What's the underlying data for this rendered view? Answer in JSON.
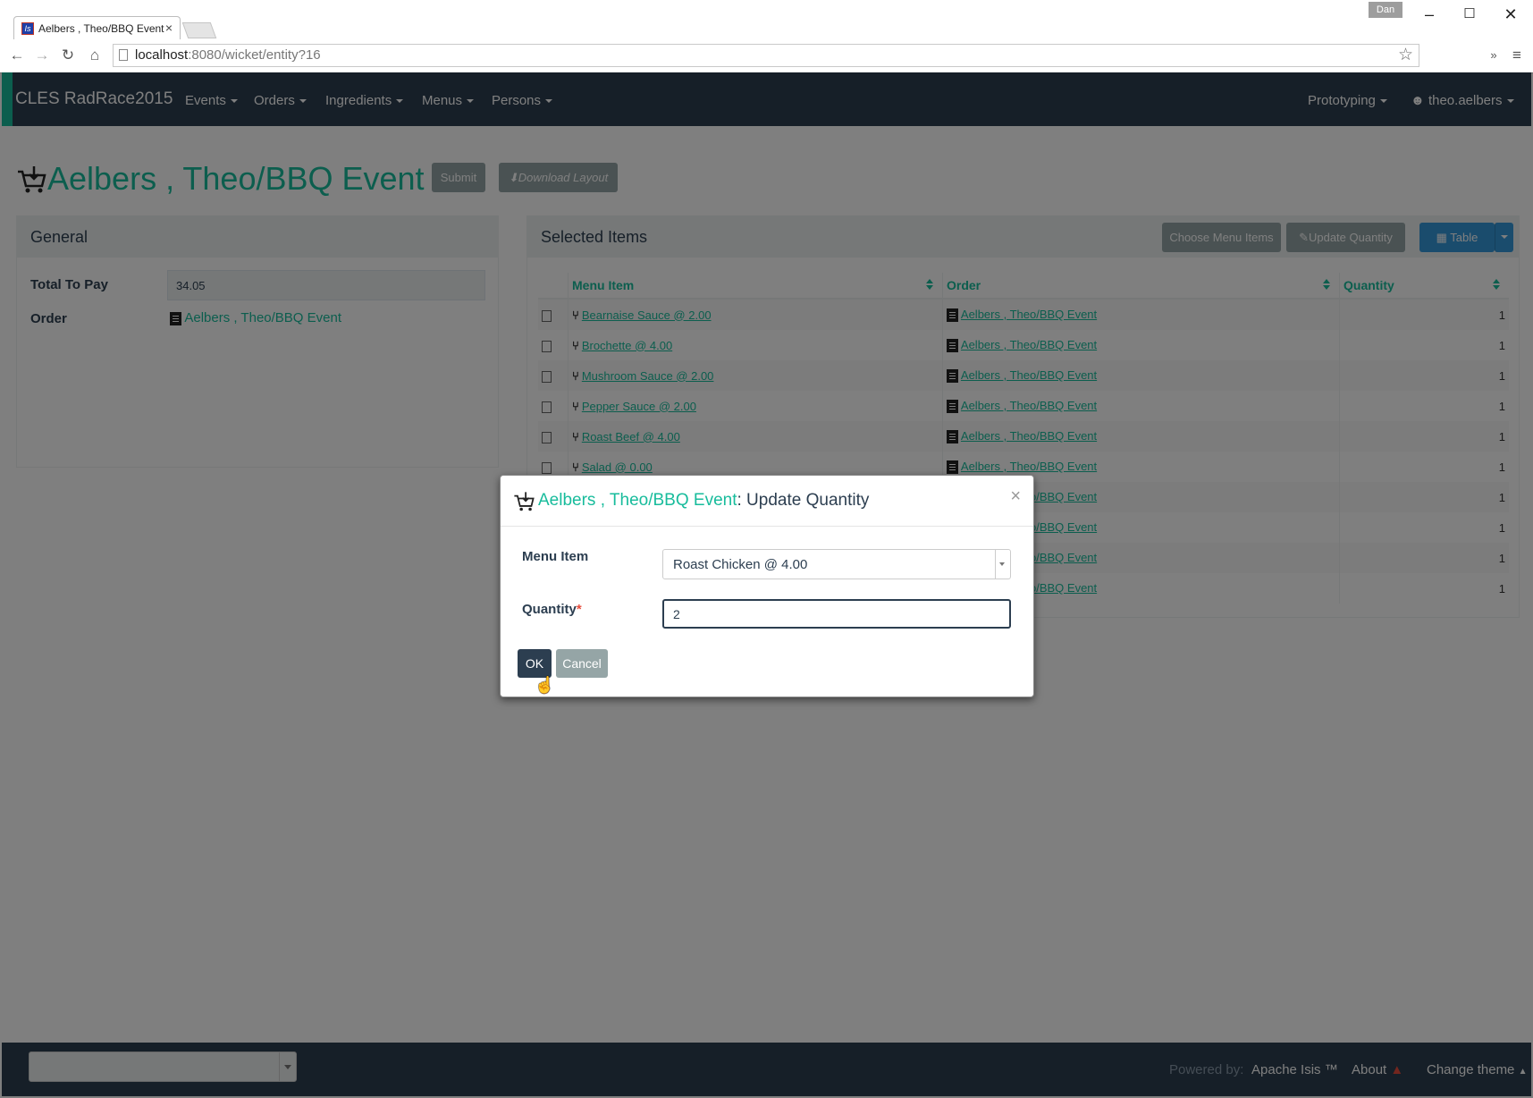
{
  "browser": {
    "tab_title": "Aelbers , Theo/BBQ Event",
    "tab_favicon": "Is",
    "user_badge": "Dan",
    "url_host": "localhost",
    "url_rest": ":8080/wicket/entity?16"
  },
  "navbar": {
    "brand": "CLES RadRace2015",
    "menus": [
      "Events",
      "Orders",
      "Ingredients",
      "Menus",
      "Persons"
    ],
    "right_menu": "Prototyping",
    "user": "theo.aelbers"
  },
  "page": {
    "title": "Aelbers , Theo/BBQ Event",
    "submit_label": "Submit",
    "download_label": "Download Layout"
  },
  "general": {
    "heading": "General",
    "total_label": "Total To Pay",
    "total_value": "34.05",
    "order_label": "Order",
    "order_value": "Aelbers , Theo/BBQ Event"
  },
  "selected": {
    "heading": "Selected Items",
    "choose_label": "Choose Menu Items",
    "update_label": "Update Quantity",
    "table_label": "Table",
    "columns": [
      "Menu Item",
      "Order",
      "Quantity"
    ],
    "rows": [
      {
        "item": "Bearnaise Sauce @ 2.00",
        "order": "Aelbers , Theo/BBQ Event",
        "qty": "1"
      },
      {
        "item": "Brochette @ 4.00",
        "order": "Aelbers , Theo/BBQ Event",
        "qty": "1"
      },
      {
        "item": "Mushroom Sauce @ 2.00",
        "order": "Aelbers , Theo/BBQ Event",
        "qty": "1"
      },
      {
        "item": "Pepper Sauce @ 2.00",
        "order": "Aelbers , Theo/BBQ Event",
        "qty": "1"
      },
      {
        "item": "Roast Beef @ 4.00",
        "order": "Aelbers , Theo/BBQ Event",
        "qty": "1"
      },
      {
        "item": "Salad @ 0.00",
        "order": "Aelbers , Theo/BBQ Event",
        "qty": "1"
      },
      {
        "item": "",
        "order": "Aelbers , Theo/BBQ Event",
        "qty": "1"
      },
      {
        "item": "",
        "order": "Aelbers , Theo/BBQ Event",
        "qty": "1"
      },
      {
        "item": "",
        "order": "Aelbers , Theo/BBQ Event",
        "qty": "1"
      },
      {
        "item": "",
        "order": "Aelbers , Theo/BBQ Event",
        "qty": "1"
      }
    ]
  },
  "modal": {
    "entity": "Aelbers , Theo/BBQ Event",
    "action": ": Update Quantity",
    "close": "×",
    "menu_item_label": "Menu Item",
    "menu_item_value": "Roast Chicken @ 4.00",
    "quantity_label": "Quantity",
    "required_mark": "*",
    "quantity_value": "2",
    "ok_label": "OK",
    "cancel_label": "Cancel"
  },
  "footer": {
    "powered_by": "Powered by:",
    "apache": "Apache Isis ™",
    "about": "About",
    "change_theme": "Change theme"
  },
  "colors": {
    "navbar": "#2c3e50",
    "accent": "#18bc9c",
    "primary_button": "#3498db"
  }
}
